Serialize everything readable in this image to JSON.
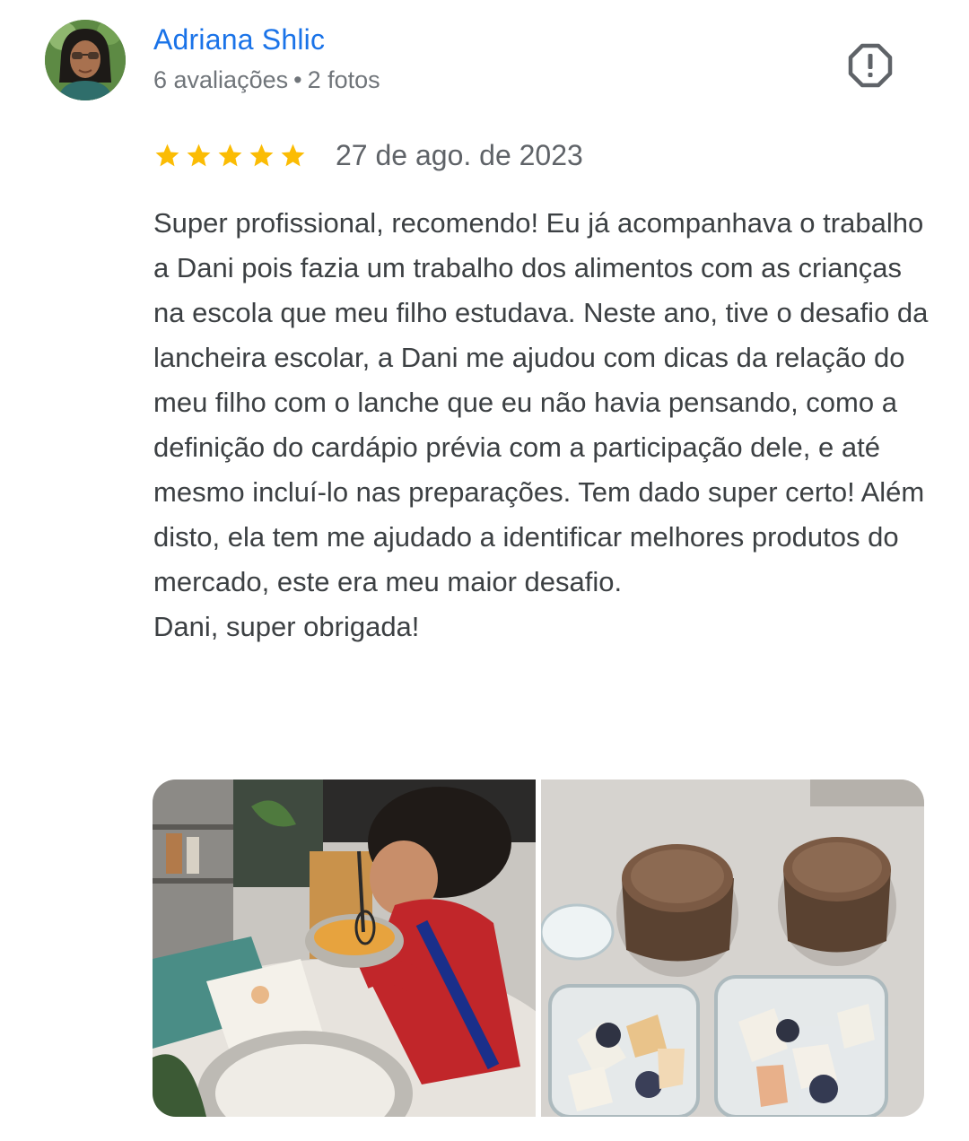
{
  "author": {
    "name": "Adriana Shlic",
    "reviews_count": "6 avaliações",
    "separator": "•",
    "photos_count": "2 fotos",
    "avatar_icon": "user-avatar"
  },
  "report": {
    "icon": "report-flag-icon",
    "color": "#5f6368"
  },
  "rating": {
    "stars": 5,
    "max_stars": 5,
    "star_color": "#fbbc04",
    "date": "27 de ago. de 2023"
  },
  "review": {
    "text": "Super profissional, recomendo! Eu já acompanhava o trabalho a Dani pois fazia um trabalho dos alimentos com as crianças na escola que meu filho estudava. Neste ano, tive o desafio da lancheira escolar, a Dani me ajudou com dicas da relação do meu filho com o lanche que eu não havia pensando, como a definição do cardápio prévia com a participação dele, e até mesmo incluí-lo nas preparações. Tem dado super certo! Além disto, ela tem me ajudado a identificar melhores produtos do mercado, este era meu maior desafio.\nDani, super obrigada!"
  },
  "photos": [
    {
      "icon": "photo-child-cooking"
    },
    {
      "icon": "photo-lunchbox-food"
    }
  ],
  "colors": {
    "accent": "#1a73e8",
    "text": "#3c4043",
    "secondary_text": "#70757a"
  }
}
